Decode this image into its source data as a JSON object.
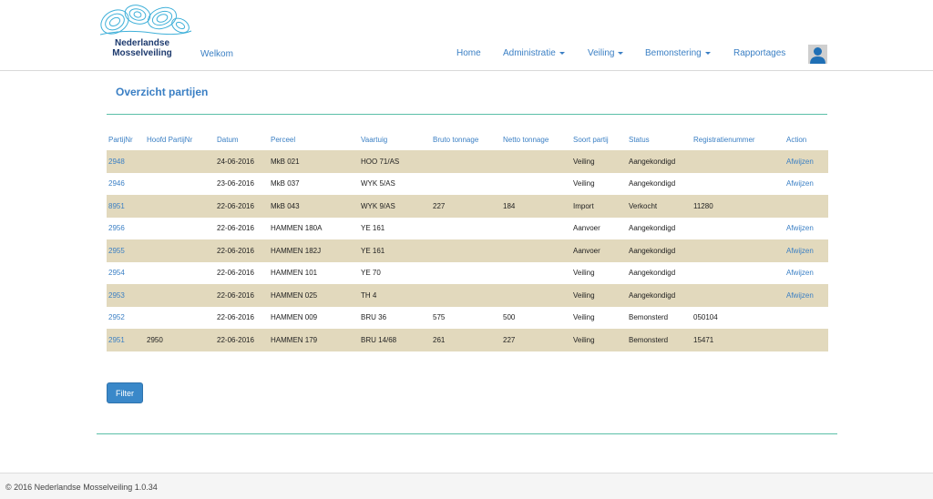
{
  "brand": {
    "line1": "Nederlandse",
    "line2": "Mosselveiling",
    "logo_color": "#3fb0d9"
  },
  "header": {
    "welcome": "Welkom",
    "nav": {
      "home": "Home",
      "administratie": "Administratie",
      "veiling": "Veiling",
      "bemonstering": "Bemonstering",
      "rapportages": "Rapportages"
    }
  },
  "main": {
    "title": "Overzicht partijen",
    "columns": [
      "PartijNr",
      "Hoofd PartijNr",
      "Datum",
      "Perceel",
      "Vaartuig",
      "Bruto tonnage",
      "Netto tonnage",
      "Soort partij",
      "Status",
      "Registratienummer",
      "Action"
    ],
    "rows": [
      [
        "2948",
        "",
        "24-06-2016",
        "MkB 021",
        "HOO 71/AS",
        "",
        "",
        "Veiling",
        "Aangekondigd",
        "",
        "Afwijzen"
      ],
      [
        "2946",
        "",
        "23-06-2016",
        "MkB 037",
        "WYK 5/AS",
        "",
        "",
        "Veiling",
        "Aangekondigd",
        "",
        "Afwijzen"
      ],
      [
        "8951",
        "",
        "22-06-2016",
        "MkB 043",
        "WYK 9/AS",
        "227",
        "184",
        "Import",
        "Verkocht",
        "11280",
        ""
      ],
      [
        "2956",
        "",
        "22-06-2016",
        "HAMMEN 180A",
        "YE 161",
        "",
        "",
        "Aanvoer",
        "Aangekondigd",
        "",
        "Afwijzen"
      ],
      [
        "2955",
        "",
        "22-06-2016",
        "HAMMEN 182J",
        "YE 161",
        "",
        "",
        "Aanvoer",
        "Aangekondigd",
        "",
        "Afwijzen"
      ],
      [
        "2954",
        "",
        "22-06-2016",
        "HAMMEN 101",
        "YE 70",
        "",
        "",
        "Veiling",
        "Aangekondigd",
        "",
        "Afwijzen"
      ],
      [
        "2953",
        "",
        "22-06-2016",
        "HAMMEN 025",
        "TH 4",
        "",
        "",
        "Veiling",
        "Aangekondigd",
        "",
        "Afwijzen"
      ],
      [
        "2952",
        "",
        "22-06-2016",
        "HAMMEN 009",
        "BRU 36",
        "575",
        "500",
        "Veiling",
        "Bemonsterd",
        "050104",
        ""
      ],
      [
        "2951",
        "2950",
        "22-06-2016",
        "HAMMEN 179",
        "BRU 14/68",
        "261",
        "227",
        "Veiling",
        "Bemonsterd",
        "15471",
        ""
      ]
    ],
    "filter_label": "Filter"
  },
  "footer": {
    "text": "© 2016 Nederlandse Mosselveiling 1.0.34"
  },
  "colors": {
    "link": "#3a7fc4",
    "row_stripe": "#e2d9bd",
    "rule": "#5bbfa8",
    "button": "#3a88c9"
  }
}
